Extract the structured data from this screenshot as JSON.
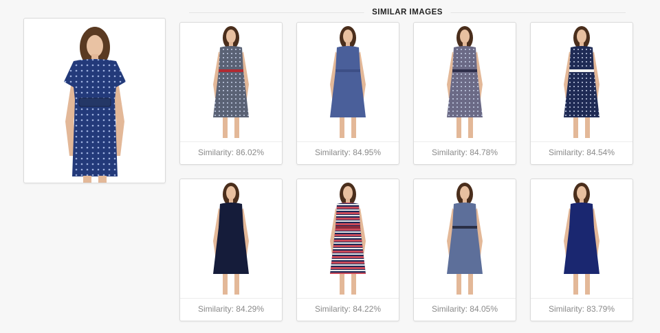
{
  "section": {
    "title": "SIMILAR IMAGES"
  },
  "query": {
    "dress_color": "#233a7a",
    "pattern": "dots"
  },
  "results": [
    {
      "caption": "Similarity: 86.02%",
      "dress_color": "#5a6275",
      "pattern": "dots",
      "accent": "#b02a32"
    },
    {
      "caption": "Similarity: 84.95%",
      "dress_color": "#4a5f9a",
      "pattern": "solid",
      "accent": "#3d4f86"
    },
    {
      "caption": "Similarity: 84.78%",
      "dress_color": "#6b6a86",
      "pattern": "dots",
      "accent": "#2f2f4a"
    },
    {
      "caption": "Similarity: 84.54%",
      "dress_color": "#1f2b55",
      "pattern": "dots",
      "accent": "#f2f2f2"
    },
    {
      "caption": "Similarity: 84.29%",
      "dress_color": "#151c3a",
      "pattern": "solid",
      "accent": "#151c3a"
    },
    {
      "caption": "Similarity: 84.22%",
      "dress_color": "#1c2755",
      "pattern": "stripes",
      "accent": "#8a2a3a"
    },
    {
      "caption": "Similarity: 84.05%",
      "dress_color": "#5d6f9a",
      "pattern": "solid",
      "accent": "#2a2f45"
    },
    {
      "caption": "Similarity: 83.79%",
      "dress_color": "#1a2770",
      "pattern": "solid",
      "accent": "#1a2770"
    }
  ]
}
